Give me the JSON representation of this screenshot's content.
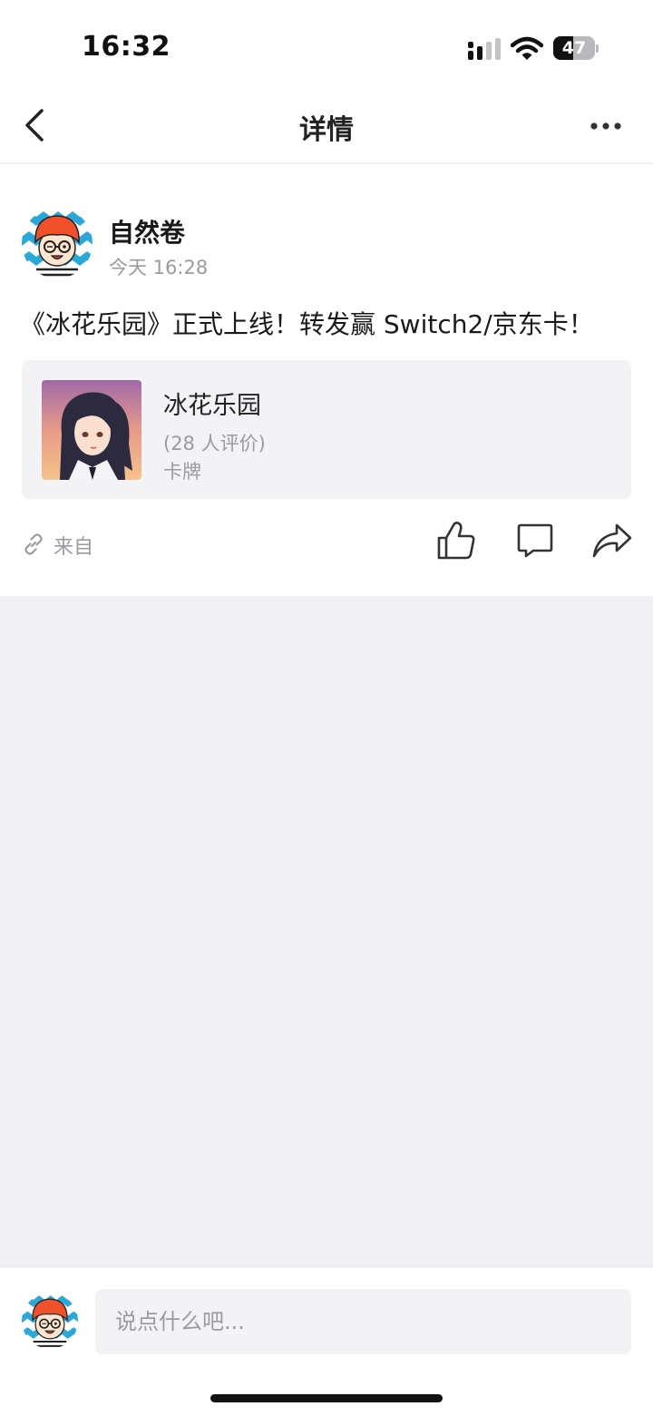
{
  "status_bar": {
    "time": "16:32",
    "battery_level": "47",
    "battery_fraction": 0.47,
    "icons": [
      "signal-icon",
      "wifi-icon",
      "battery-icon"
    ]
  },
  "nav": {
    "title": "详情",
    "back_icon": "chevron-left-icon",
    "more_icon": "more-dots-icon"
  },
  "post": {
    "author": "自然卷",
    "time": "今天 16:28",
    "text": "《冰花乐园》正式上线！转发赢 Switch2/京东卡！",
    "game": {
      "name": "冰花乐园",
      "rating": "(28 人评价)",
      "tag": "卡牌"
    },
    "source_label": "来自",
    "actions": [
      "like-icon",
      "comment-icon",
      "share-icon"
    ]
  },
  "comment_box": {
    "placeholder": "说点什么吧..."
  },
  "colors": {
    "background": "#f1f1f5",
    "card": "#f3f3f6",
    "text_primary": "#1a1a1a",
    "text_secondary": "#9a9aa0",
    "avatar_hair": "#f0502a",
    "avatar_bg": "#2aa8d8"
  }
}
